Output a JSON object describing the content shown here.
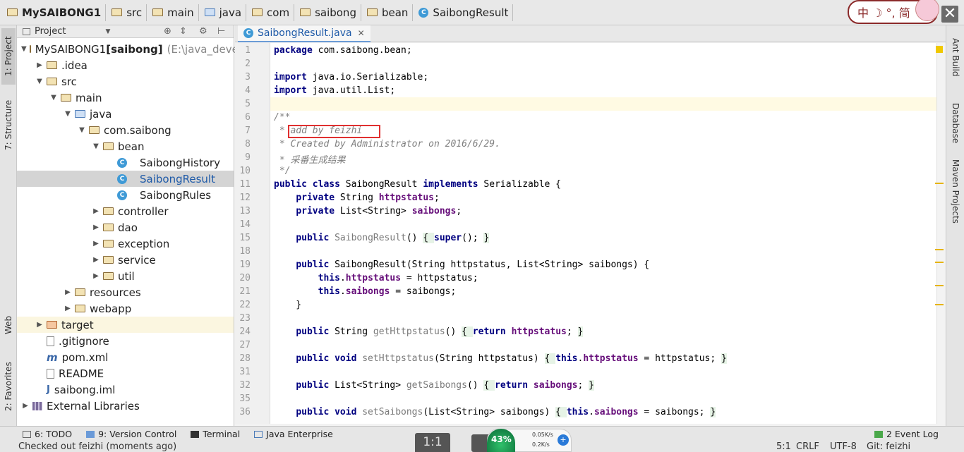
{
  "breadcrumb": [
    "MySAIBONG1",
    "src",
    "main",
    "java",
    "com",
    "saibong",
    "bean",
    "SaibongResult"
  ],
  "ime": {
    "label": "中 ☽ °, 简"
  },
  "left_tabs": {
    "project": "1: Project",
    "structure": "7: Structure",
    "web": "Web",
    "favorites": "2: Favorites"
  },
  "right_tabs": {
    "ant": "Ant Build",
    "database": "Database",
    "maven": "Maven Projects"
  },
  "project_panel": {
    "title": "Project"
  },
  "tree": [
    {
      "label": "MySAIBONG1",
      "bold_suffix": "[saibong]",
      "path_hint": "E:\\java_develop",
      "indent": 0,
      "expanded": true,
      "icon": "folder-icon"
    },
    {
      "label": ".idea",
      "indent": 1,
      "expanded": false,
      "icon": "folder-icon"
    },
    {
      "label": "src",
      "indent": 1,
      "expanded": true,
      "icon": "folder-icon"
    },
    {
      "label": "main",
      "indent": 2,
      "expanded": true,
      "icon": "folder-icon"
    },
    {
      "label": "java",
      "indent": 3,
      "expanded": true,
      "icon": "source-folder-icon"
    },
    {
      "label": "com.saibong",
      "indent": 4,
      "expanded": true,
      "icon": "package-icon"
    },
    {
      "label": "bean",
      "indent": 5,
      "expanded": true,
      "icon": "package-icon"
    },
    {
      "label": "SaibongHistory",
      "indent": 6,
      "icon": "class-icon"
    },
    {
      "label": "SaibongResult",
      "indent": 6,
      "icon": "class-icon",
      "selected": true
    },
    {
      "label": "SaibongRules",
      "indent": 6,
      "icon": "class-icon"
    },
    {
      "label": "controller",
      "indent": 5,
      "expanded": false,
      "icon": "package-icon"
    },
    {
      "label": "dao",
      "indent": 5,
      "expanded": false,
      "icon": "package-icon"
    },
    {
      "label": "exception",
      "indent": 5,
      "expanded": false,
      "icon": "package-icon"
    },
    {
      "label": "service",
      "indent": 5,
      "expanded": false,
      "icon": "package-icon"
    },
    {
      "label": "util",
      "indent": 5,
      "expanded": false,
      "icon": "package-icon"
    },
    {
      "label": "resources",
      "indent": 3,
      "expanded": false,
      "icon": "folder-icon"
    },
    {
      "label": "webapp",
      "indent": 3,
      "expanded": false,
      "icon": "folder-icon"
    },
    {
      "label": "target",
      "indent": 1,
      "expanded": false,
      "icon": "folder-orange-icon",
      "highlight": true
    },
    {
      "label": ".gitignore",
      "indent": 1,
      "icon": "file-icon"
    },
    {
      "label": "pom.xml",
      "indent": 1,
      "icon": "maven-icon"
    },
    {
      "label": "README",
      "indent": 1,
      "icon": "file-icon"
    },
    {
      "label": "saibong.iml",
      "indent": 1,
      "icon": "iml-icon"
    },
    {
      "label": "External Libraries",
      "indent": 0,
      "expanded": false,
      "icon": "library-icon"
    }
  ],
  "editor": {
    "tab_label": "SaibongResult.java",
    "line_numbers": [
      "1",
      "2",
      "3",
      "4",
      "5",
      "6",
      "7",
      "8",
      "9",
      "10",
      "11",
      "12",
      "13",
      "14",
      "15",
      "18",
      "19",
      "20",
      "21",
      "22",
      "23",
      "24",
      "27",
      "28",
      "31",
      "32",
      "35",
      "36"
    ],
    "lines": [
      [
        {
          "t": "package",
          "c": "kw"
        },
        {
          "t": " com.saibong.bean;"
        }
      ],
      [],
      [
        {
          "t": "import",
          "c": "kw"
        },
        {
          "t": " java.io.Serializable;"
        }
      ],
      [
        {
          "t": "import",
          "c": "kw"
        },
        {
          "t": " java.util.List;"
        }
      ],
      [],
      [
        {
          "t": "/**",
          "c": "cmt"
        }
      ],
      [
        {
          "t": " * ",
          "c": "cmt"
        },
        {
          "t": "add by feizhi",
          "c": "cmt"
        }
      ],
      [
        {
          "t": " * Created by Administrator on 2016/6/29.",
          "c": "cmt"
        }
      ],
      [
        {
          "t": " * 采番生成结果",
          "c": "cmt"
        }
      ],
      [
        {
          "t": " */",
          "c": "cmt"
        }
      ],
      [
        {
          "t": "public class",
          "c": "kw"
        },
        {
          "t": " SaibongResult "
        },
        {
          "t": "implements",
          "c": "kw"
        },
        {
          "t": " Serializable {"
        }
      ],
      [
        {
          "t": "    "
        },
        {
          "t": "private",
          "c": "kw"
        },
        {
          "t": " String "
        },
        {
          "t": "httpstatus",
          "c": "fld"
        },
        {
          "t": ";"
        }
      ],
      [
        {
          "t": "    "
        },
        {
          "t": "private",
          "c": "kw"
        },
        {
          "t": " List<String> "
        },
        {
          "t": "saibongs",
          "c": "fld"
        },
        {
          "t": ";"
        }
      ],
      [],
      [
        {
          "t": "    "
        },
        {
          "t": "public",
          "c": "kw"
        },
        {
          "t": " "
        },
        {
          "t": "SaibongResult",
          "c": "fold"
        },
        {
          "t": "() "
        },
        {
          "t": "{ ",
          "c": "brace"
        },
        {
          "t": "super",
          "c": "kw"
        },
        {
          "t": "(); "
        },
        {
          "t": "}",
          "c": "brace"
        }
      ],
      [],
      [
        {
          "t": "    "
        },
        {
          "t": "public",
          "c": "kw"
        },
        {
          "t": " SaibongResult(String httpstatus, List<String> saibongs) {"
        }
      ],
      [
        {
          "t": "        "
        },
        {
          "t": "this",
          "c": "kw"
        },
        {
          "t": "."
        },
        {
          "t": "httpstatus",
          "c": "fld"
        },
        {
          "t": " = httpstatus;"
        }
      ],
      [
        {
          "t": "        "
        },
        {
          "t": "this",
          "c": "kw"
        },
        {
          "t": "."
        },
        {
          "t": "saibongs",
          "c": "fld"
        },
        {
          "t": " = saibongs;"
        }
      ],
      [
        {
          "t": "    }"
        }
      ],
      [],
      [
        {
          "t": "    "
        },
        {
          "t": "public",
          "c": "kw"
        },
        {
          "t": " String "
        },
        {
          "t": "getHttpstatus",
          "c": "fold"
        },
        {
          "t": "() "
        },
        {
          "t": "{ ",
          "c": "brace"
        },
        {
          "t": "return",
          "c": "kw"
        },
        {
          "t": " "
        },
        {
          "t": "httpstatus",
          "c": "fld"
        },
        {
          "t": "; "
        },
        {
          "t": "}",
          "c": "brace"
        }
      ],
      [],
      [
        {
          "t": "    "
        },
        {
          "t": "public void",
          "c": "kw"
        },
        {
          "t": " "
        },
        {
          "t": "setHttpstatus",
          "c": "fold"
        },
        {
          "t": "(String httpstatus) "
        },
        {
          "t": "{ ",
          "c": "brace"
        },
        {
          "t": "this",
          "c": "kw"
        },
        {
          "t": "."
        },
        {
          "t": "httpstatus",
          "c": "fld"
        },
        {
          "t": " = httpstatus; "
        },
        {
          "t": "}",
          "c": "brace"
        }
      ],
      [],
      [
        {
          "t": "    "
        },
        {
          "t": "public",
          "c": "kw"
        },
        {
          "t": " List<String> "
        },
        {
          "t": "getSaibongs",
          "c": "fold"
        },
        {
          "t": "() "
        },
        {
          "t": "{ ",
          "c": "brace"
        },
        {
          "t": "return",
          "c": "kw"
        },
        {
          "t": " "
        },
        {
          "t": "saibongs",
          "c": "fld"
        },
        {
          "t": "; "
        },
        {
          "t": "}",
          "c": "brace"
        }
      ],
      [],
      [
        {
          "t": "    "
        },
        {
          "t": "public void",
          "c": "kw"
        },
        {
          "t": " "
        },
        {
          "t": "setSaibongs",
          "c": "fold"
        },
        {
          "t": "(List<String> saibongs) "
        },
        {
          "t": "{ ",
          "c": "brace"
        },
        {
          "t": "this",
          "c": "kw"
        },
        {
          "t": "."
        },
        {
          "t": "saibongs",
          "c": "fld"
        },
        {
          "t": " = saibongs; "
        },
        {
          "t": "}",
          "c": "brace"
        }
      ]
    ]
  },
  "bottom_tabs": {
    "todo": "6: TODO",
    "vcs": "9: Version Control",
    "terminal": "Terminal",
    "java_ee": "Java Enterprise",
    "event_log": "2 Event Log"
  },
  "status": {
    "message": "Checked out feizhi (moments ago)",
    "position": "5:1",
    "line_sep": "CRLF",
    "encoding": "UTF-8",
    "git": "Git: feizhi"
  },
  "overlay": {
    "ratio": "1:1",
    "percent": "43%",
    "upload": "0.05K/s",
    "download": "0.2K/s"
  },
  "colors": {
    "keyword": "#000080",
    "field": "#660e7a",
    "comment": "#808080",
    "selection": "#d4d4d4",
    "highlight_box": "#e03030"
  }
}
